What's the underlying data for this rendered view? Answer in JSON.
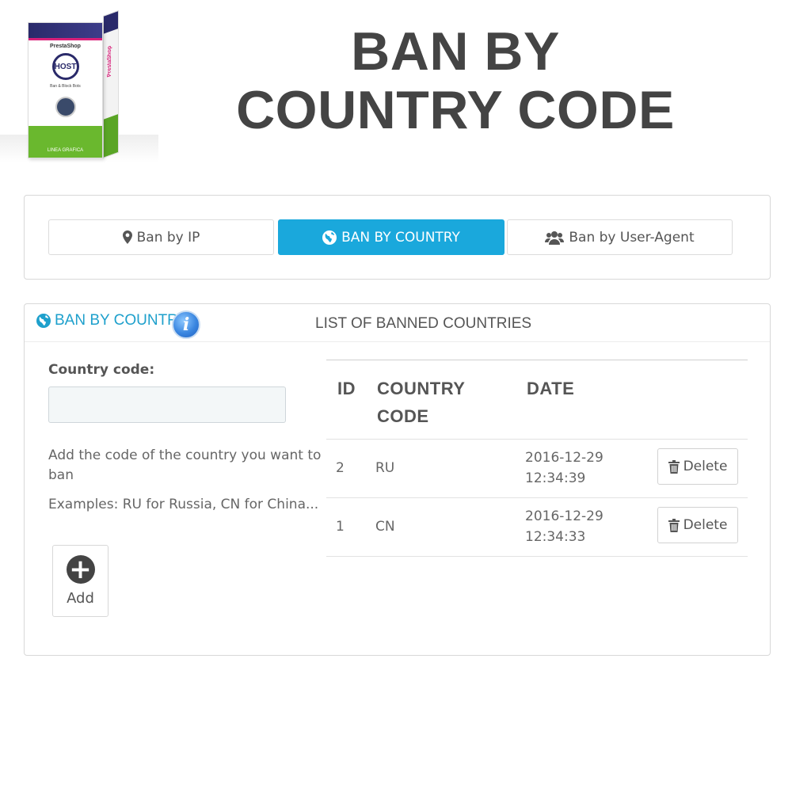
{
  "product": {
    "brand": "PrestaShop",
    "logo_text": "HOST",
    "name": "Ban & Block Bots",
    "maker": "LINEA GRAFICA",
    "side_text": "PrestaShop"
  },
  "headline": {
    "line1": "BAN BY",
    "line2": "COUNTRY CODE"
  },
  "tabs": [
    {
      "label": "Ban by IP",
      "icon": "map-marker-icon",
      "active": false
    },
    {
      "label": "BAN BY COUNTRY",
      "icon": "globe-icon",
      "active": true
    },
    {
      "label": "Ban by User-Agent",
      "icon": "users-icon",
      "active": false
    }
  ],
  "panel": {
    "title": "BAN BY COUNTRY",
    "info_icon_glyph": "i",
    "list_title": "LIST OF BANNED COUNTRIES"
  },
  "form": {
    "label": "Country code:",
    "value": "",
    "help": "Add the code of the country you want to ban",
    "examples": "Examples: RU for Russia, CN for China...",
    "add_label": "Add",
    "add_glyph": "+"
  },
  "table": {
    "headers": {
      "id": "ID",
      "country_code": "COUNTRY CODE",
      "date": "DATE"
    },
    "rows": [
      {
        "id": "2",
        "country_code": "RU",
        "date": "2016-12-29 12:34:39",
        "action": "Delete"
      },
      {
        "id": "1",
        "country_code": "CN",
        "date": "2016-12-29 12:34:33",
        "action": "Delete"
      }
    ]
  },
  "colors": {
    "accent": "#1aa8dc",
    "title_blue": "#1ea0cc",
    "headline": "#444444",
    "product_green": "#6ab82e",
    "product_navy": "#2a2a6a"
  }
}
